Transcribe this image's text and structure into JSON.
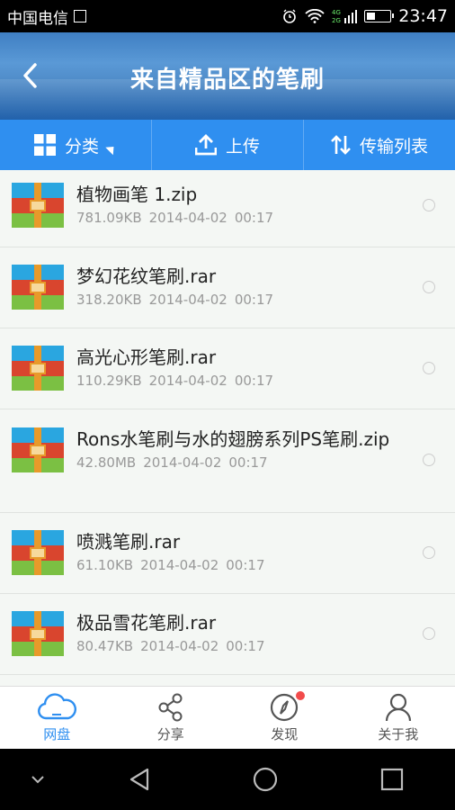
{
  "status_bar": {
    "carrier": "中国电信",
    "time": "23:47"
  },
  "header": {
    "title": "来自精品区的笔刷"
  },
  "toolbar": {
    "category_label": "分类",
    "upload_label": "上传",
    "transfer_label": "传输列表"
  },
  "files": [
    {
      "name": "植物画笔 1.zip",
      "size": "781.09KB",
      "date": "2014-04-02",
      "time": "00:17"
    },
    {
      "name": "梦幻花纹笔刷.rar",
      "size": "318.20KB",
      "date": "2014-04-02",
      "time": "00:17"
    },
    {
      "name": "高光心形笔刷.rar",
      "size": "110.29KB",
      "date": "2014-04-02",
      "time": "00:17"
    },
    {
      "name": "Rons水笔刷与水的翅膀系列PS笔刷.zip",
      "size": "42.80MB",
      "date": "2014-04-02",
      "time": "00:17"
    },
    {
      "name": "喷溅笔刷.rar",
      "size": "61.10KB",
      "date": "2014-04-02",
      "time": "00:17"
    },
    {
      "name": "极品雪花笔刷.rar",
      "size": "80.47KB",
      "date": "2014-04-02",
      "time": "00:17"
    }
  ],
  "bottom_nav": {
    "netdisk": "网盘",
    "share": "分享",
    "discover": "发现",
    "about": "关于我"
  },
  "colors": {
    "accent": "#2f8ff0",
    "badge": "#f24b4b"
  }
}
